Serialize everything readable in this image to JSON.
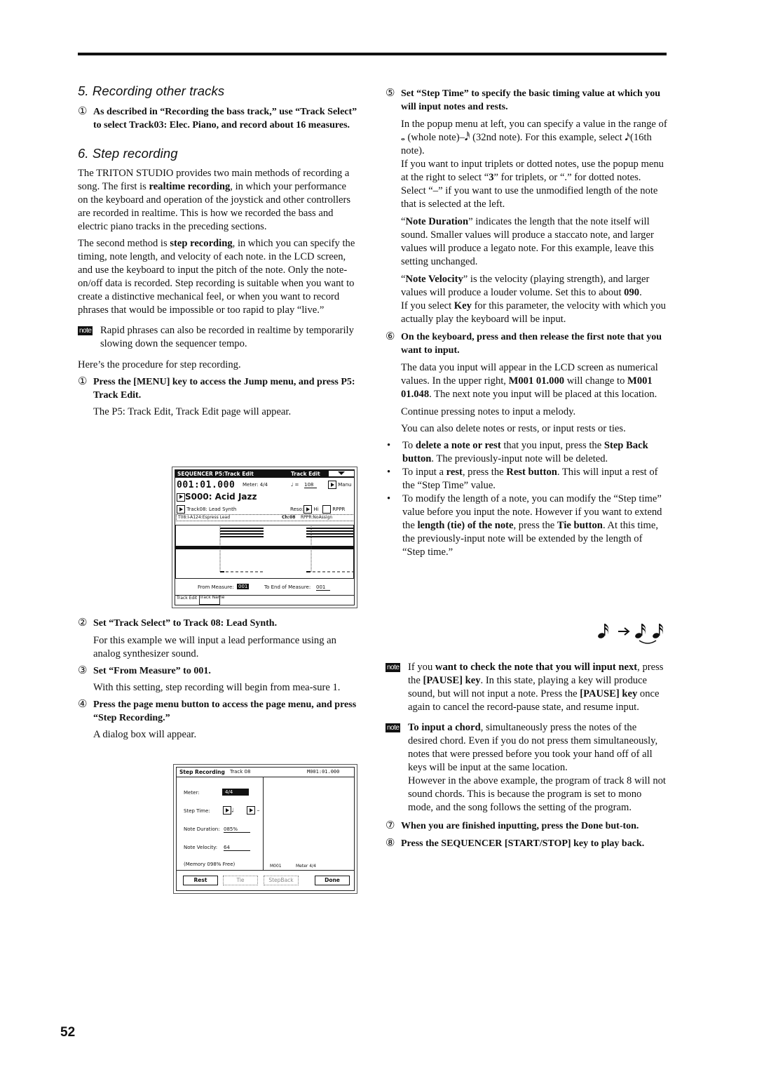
{
  "page": {
    "number": "52"
  },
  "section5": {
    "heading": "5. Recording other tracks",
    "step1": {
      "num": "①",
      "text": "As described in “Recording the bass track,” use “Track Select” to select Track03: Elec. Piano, and record about 16 measures."
    }
  },
  "section6": {
    "heading": "6. Step recording",
    "intro_p1": {
      "a": "The TRITON STUDIO provides two main methods of recording a song. The first is ",
      "bold": "realtime recording",
      "b": ", in which your performance on the keyboard and operation of the joystick and other controllers are recorded in realtime. This is how we recorded the bass and electric piano tracks in the preceding sections."
    },
    "intro_p2": {
      "a": "The second method is ",
      "bold": "step recording",
      "b": ", in which you can specify the timing, note length, and velocity of each note. in the LCD screen, and use the keyboard to input the pitch of the note. Only the note-on/off data is recorded. Step recording is suitable when you want to create a distinctive mechanical feel, or when you want to record phrases that would be impossible or too rapid to play “live.”"
    },
    "note1": {
      "badge": "note",
      "text": "Rapid phrases can also be recorded in realtime by temporarily slowing down the sequencer tempo."
    },
    "procedure_intro": "Here’s the procedure for step recording.",
    "step1": {
      "num": "①",
      "text": "Press the [MENU] key to access the Jump menu, and press P5: Track Edit.",
      "body": "The P5: Track Edit, Track Edit page will appear."
    },
    "step2": {
      "num": "②",
      "text": "Set “Track Select” to Track 08: Lead Synth.",
      "body": "For this example we will input a lead performance using an analog synthesizer sound."
    },
    "step3": {
      "num": "③",
      "text": "Set “From Measure” to 001.",
      "body": "With this setting, step recording will begin from mea-sure 1."
    },
    "step4": {
      "num": "④",
      "text": "Press the page menu button to access the page menu, and press “Step Recording.”",
      "body": "A dialog box will appear."
    },
    "step5": {
      "num": "⑤",
      "text": "Set “Step Time” to specify the basic timing value at which you will input notes and rests.",
      "p1a": "In the popup menu at left, you can specify a value in the range of ",
      "whole_note": "𝅝",
      "p1b": " (whole note)–",
      "n32": "𝅘𝅥𝅰",
      "p1c": " (32nd note). For this example, select ",
      "n16": "𝅘𝅥𝅯",
      "p1d": "(16th note).",
      "p2a": "If you want to input triplets or dotted notes, use the popup menu at the right to select “",
      "p2bold": "3",
      "p2b": "” for triplets, or “.” for dotted notes. Select “–” if you want to use the unmodified length of the note that is selected at the left.",
      "p3a": "“",
      "p3bold": "Note Duration",
      "p3b": "” indicates the length that the note itself will sound. Smaller values will produce a staccato note, and larger values will produce a legato note. For this example, leave this setting unchanged.",
      "p4a": "“",
      "p4bold": "Note Velocity",
      "p4b": "” is the velocity (playing strength), and larger values will produce a louder volume. Set this to about ",
      "p4bold2": "090",
      "p4c": ".",
      "p5a": "If you select ",
      "p5bold": "Key",
      "p5b": " for this parameter, the velocity with which you actually play the keyboard will be input."
    },
    "step6": {
      "num": "⑥",
      "text": "On the keyboard, press and then release the first note that you want to input.",
      "p1a": "The data you input will appear in the LCD screen as numerical values. In the upper right, ",
      "p1bold1": "M001 01.000",
      "p1b": " will change to ",
      "p1bold2": "M001 01.048",
      "p1c": ". The next note you input will be placed at this location.",
      "p2": "Continue pressing notes to input a melody.",
      "p3": "You can also delete notes or rests, or input rests or ties.",
      "bullets": [
        {
          "a": "To ",
          "b1": "delete a note or rest",
          "c": " that you input, press the ",
          "b2": "Step Back button",
          "d": ". The previously-input note will be deleted."
        },
        {
          "a": "To input a ",
          "b1": "rest",
          "c": ", press the ",
          "b2": "Rest button",
          "d": ". This will input a rest of the “Step Time” value."
        },
        {
          "a": "To modify the length of a note, you can modify the “Step time” value before you input the note. However if you want to extend the ",
          "b1": "length (tie) of the note",
          "c": ", press the ",
          "b2": "Tie button",
          "d": ". At this time, the previously-input note will be extended by the length of “Step time.”"
        }
      ],
      "tie_figure": {
        "left": "𝅘𝅥𝅯",
        "arrow": "→",
        "right": "𝅘𝅥𝅯𝅘𝅥𝅯"
      }
    },
    "note2": {
      "badge": "note",
      "a": "If you ",
      "b1": "want to check the note that you will input next",
      "c": ", press the ",
      "b2": "[PAUSE] key",
      "d": ". In this state, playing a key will produce sound, but will not input a note. Press the ",
      "b3": "[PAUSE] key",
      "e": " once again to cancel the record-pause state, and resume input."
    },
    "note3": {
      "badge": "note",
      "b1": "To input a chord",
      "a": ", simultaneously press the notes of the desired chord. Even if you do not press them simultaneously, notes that were pressed before you took your hand off of all keys will be input at the same location.",
      "p2": "However in the above example, the program of track 8 will not sound chords. This is because the program is set to mono mode, and the song follows the setting of the program."
    },
    "step7": {
      "num": "⑦",
      "text": "When you are finished inputting, press the Done but-ton."
    },
    "step8": {
      "num": "⑧",
      "text": "Press the SEQUENCER [START/STOP] key to play back."
    }
  },
  "lcd_track_edit": {
    "title_left": "SEQUENCER P5:Track Edit",
    "title_right": "Track Edit",
    "position": "001:01.000",
    "meter": "Meter: 4/4",
    "tempo_label": "♩ =",
    "tempo": "108",
    "manu": "Manu",
    "song": "S000: Acid Jazz",
    "track": "Track08: Lead Synth",
    "reso_label": "Reso:",
    "reso": "Hi",
    "rppr": "RPPR",
    "info_left": "T08:I-A124:Espress Lead",
    "info_ch": "Ch:08",
    "info_rppr": "RPPR:NoAssign",
    "from_label": "From Measure:",
    "from_value": "001",
    "to_label": "To End of Measure:",
    "to_value": "001",
    "tabs": [
      "Track Edit",
      "Track Name"
    ]
  },
  "lcd_step_rec": {
    "title": "Step Recording",
    "track": "Track 08",
    "location": "M001:01.000",
    "meter_label": "Meter:",
    "meter_value": "4/4",
    "step_time_label": "Step Time:",
    "step_time_note": "♩",
    "step_time_mod": "–",
    "note_duration_label": "Note Duration:",
    "note_duration_value": "085%",
    "note_velocity_label": "Note Velocity:",
    "note_velocity_value": "64",
    "memory": "(Memory 098% Free)",
    "measure": "M001",
    "meter_right": "Meter  4/4",
    "buttons": {
      "rest": "Rest",
      "tie": "Tie",
      "step_back": "StepBack",
      "done": "Done"
    }
  }
}
